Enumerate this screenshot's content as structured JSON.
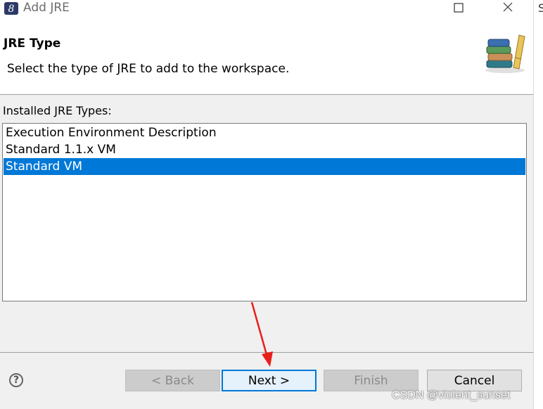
{
  "window": {
    "title": "Add JRE",
    "icon": "eclipse-app-icon",
    "maximize_icon": "maximize-icon",
    "close_icon": "close-icon"
  },
  "side_strip_letter": "S",
  "header": {
    "title": "JRE Type",
    "description": "Select the type of JRE to add to the workspace.",
    "banner_icon": "library-books-icon"
  },
  "list": {
    "label": "Installed JRE Types:",
    "items": [
      {
        "label": "Execution Environment Description",
        "selected": false
      },
      {
        "label": "Standard 1.1.x VM",
        "selected": false
      },
      {
        "label": "Standard VM",
        "selected": true
      }
    ]
  },
  "footer": {
    "help_label": "?",
    "buttons": {
      "back": "< Back",
      "next": "Next >",
      "finish": "Finish",
      "cancel": "Cancel"
    }
  },
  "watermark": "CSDN @violent_sunset",
  "colors": {
    "selection": "#0078d7",
    "annotation_arrow": "#e8201a"
  }
}
